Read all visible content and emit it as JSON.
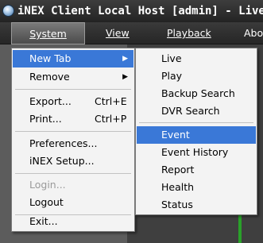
{
  "window": {
    "title": "iNEX Client Local Host [admin] - Live I"
  },
  "menubar": {
    "system": "System",
    "view": "View",
    "playback": "Playback",
    "about": "Abo"
  },
  "system_menu": {
    "new_tab": "New Tab",
    "remove": "Remove",
    "export": "Export...",
    "export_shortcut": "Ctrl+E",
    "print": "Print...",
    "print_shortcut": "Ctrl+P",
    "preferences": "Preferences...",
    "inex_setup": "iNEX Setup...",
    "login": "Login...",
    "logout": "Logout",
    "exit": "Exit..."
  },
  "new_tab_submenu": {
    "live": "Live",
    "play": "Play",
    "backup_search": "Backup Search",
    "dvr_search": "DVR Search",
    "event": "Event",
    "event_history": "Event History",
    "report": "Report",
    "health": "Health",
    "status": "Status"
  },
  "icons": {
    "app": "globe-icon",
    "submenu_arrow": "triangle-right-icon"
  },
  "colors": {
    "highlight": "#3a78d7",
    "menu_background": "#f3f3f3",
    "title_bar": "#2b2b2b",
    "disabled_text": "#9a9a9a"
  }
}
